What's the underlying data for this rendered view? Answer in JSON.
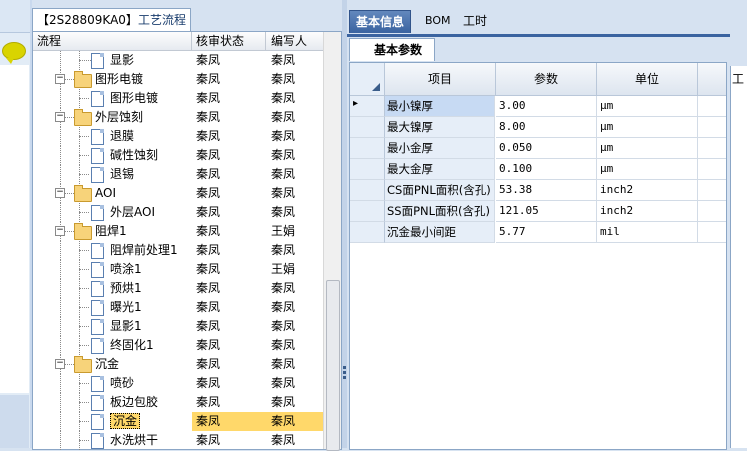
{
  "tree_panel": {
    "tab_code": "【2S28809KA0】",
    "tab_title": "工艺流程",
    "columns": [
      "流程",
      "核审状态",
      "编写人"
    ],
    "rows": [
      {
        "name": "显影",
        "status": "秦凤",
        "writer": "秦凤",
        "level": 3,
        "type": "doc"
      },
      {
        "name": "图形电镀",
        "status": "秦凤",
        "writer": "秦凤",
        "level": 1,
        "type": "folder"
      },
      {
        "name": "图形电镀",
        "status": "秦凤",
        "writer": "秦凤",
        "level": 2,
        "type": "doc"
      },
      {
        "name": "外层蚀刻",
        "status": "秦凤",
        "writer": "秦凤",
        "level": 1,
        "type": "folder"
      },
      {
        "name": "退膜",
        "status": "秦凤",
        "writer": "秦凤",
        "level": 2,
        "type": "doc"
      },
      {
        "name": "碱性蚀刻",
        "status": "秦凤",
        "writer": "秦凤",
        "level": 2,
        "type": "doc"
      },
      {
        "name": "退锡",
        "status": "秦凤",
        "writer": "秦凤",
        "level": 2,
        "type": "doc"
      },
      {
        "name": "AOI",
        "status": "秦凤",
        "writer": "秦凤",
        "level": 1,
        "type": "folder"
      },
      {
        "name": "外层AOI",
        "status": "秦凤",
        "writer": "秦凤",
        "level": 2,
        "type": "doc"
      },
      {
        "name": "阻焊1",
        "status": "秦凤",
        "writer": "王娟",
        "level": 1,
        "type": "folder"
      },
      {
        "name": "阻焊前处理1",
        "status": "秦凤",
        "writer": "秦凤",
        "level": 2,
        "type": "doc"
      },
      {
        "name": "喷涂1",
        "status": "秦凤",
        "writer": "王娟",
        "level": 2,
        "type": "doc"
      },
      {
        "name": "预烘1",
        "status": "秦凤",
        "writer": "秦凤",
        "level": 2,
        "type": "doc"
      },
      {
        "name": "曝光1",
        "status": "秦凤",
        "writer": "秦凤",
        "level": 2,
        "type": "doc"
      },
      {
        "name": "显影1",
        "status": "秦凤",
        "writer": "秦凤",
        "level": 2,
        "type": "doc"
      },
      {
        "name": "终固化1",
        "status": "秦凤",
        "writer": "秦凤",
        "level": 2,
        "type": "doc"
      },
      {
        "name": "沉金",
        "status": "秦凤",
        "writer": "秦凤",
        "level": 1,
        "type": "folder"
      },
      {
        "name": "喷砂",
        "status": "秦凤",
        "writer": "秦凤",
        "level": 2,
        "type": "doc"
      },
      {
        "name": "板边包胶",
        "status": "秦凤",
        "writer": "秦凤",
        "level": 2,
        "type": "doc"
      },
      {
        "name": "沉金",
        "status": "秦凤",
        "writer": "秦凤",
        "level": 2,
        "type": "doc",
        "selected": true
      },
      {
        "name": "水洗烘干",
        "status": "秦凤",
        "writer": "秦凤",
        "level": 2,
        "type": "doc"
      }
    ]
  },
  "right_panel": {
    "tabs": [
      "基本信息",
      "BOM",
      "工时"
    ],
    "active_tab": 0,
    "sub_tab": "基本参数",
    "grid_columns": [
      "项目",
      "参数",
      "单位"
    ],
    "grid_rows": [
      {
        "item": "最小镍厚",
        "value": "3.00",
        "unit": "μm"
      },
      {
        "item": "最大镍厚",
        "value": "8.00",
        "unit": "μm"
      },
      {
        "item": "最小金厚",
        "value": "0.050",
        "unit": "μm"
      },
      {
        "item": "最大金厚",
        "value": "0.100",
        "unit": "μm"
      },
      {
        "item": "CS面PNL面积(含孔)",
        "value": "53.38",
        "unit": "inch2"
      },
      {
        "item": "SS面PNL面积(含孔)",
        "value": "121.05",
        "unit": "inch2"
      },
      {
        "item": "沉金最小间距",
        "value": "5.77",
        "unit": "mil"
      }
    ],
    "current_row_marker": "▸"
  },
  "far_right": {
    "tab_label": "工"
  },
  "colors": {
    "tab_active": "#3a63a0",
    "selection": "#ffd86a",
    "panel_bg": "#d6e2f1",
    "border": "#8ba6c6"
  },
  "icons": {
    "folder": "folder-icon",
    "doc": "document-icon",
    "expander": "collapse-minus-icon",
    "chat": "chat-bubble-icon"
  }
}
